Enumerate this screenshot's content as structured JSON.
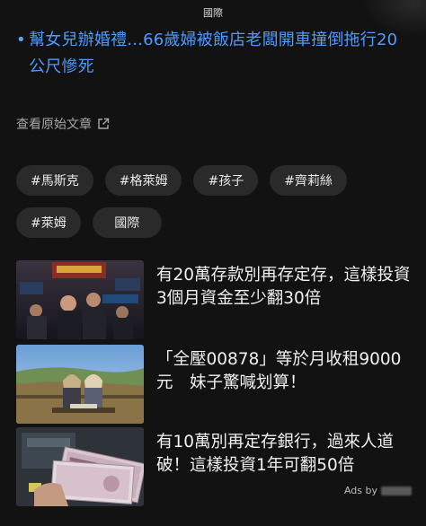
{
  "header": {
    "title": "國際"
  },
  "related_article": {
    "title": "幫女兒辦婚禮...66歲婦被飯店老闆開車撞倒拖行20公尺慘死"
  },
  "source_link": {
    "label": "查看原始文章"
  },
  "tags": [
    "#馬斯克",
    "#格萊姆",
    "#孩子",
    "#齊莉絲",
    "#萊姆",
    "國際"
  ],
  "ads": [
    {
      "text": "有20萬存款別再存定存，這樣投資3個月資金至少翻30倍"
    },
    {
      "text": "「全壓00878」等於月收租9000元　妹子驚喊划算！"
    },
    {
      "text": "有10萬別再定存銀行，過來人道破！這樣投資1年可翻50倍"
    }
  ],
  "ads_label": "Ads by"
}
